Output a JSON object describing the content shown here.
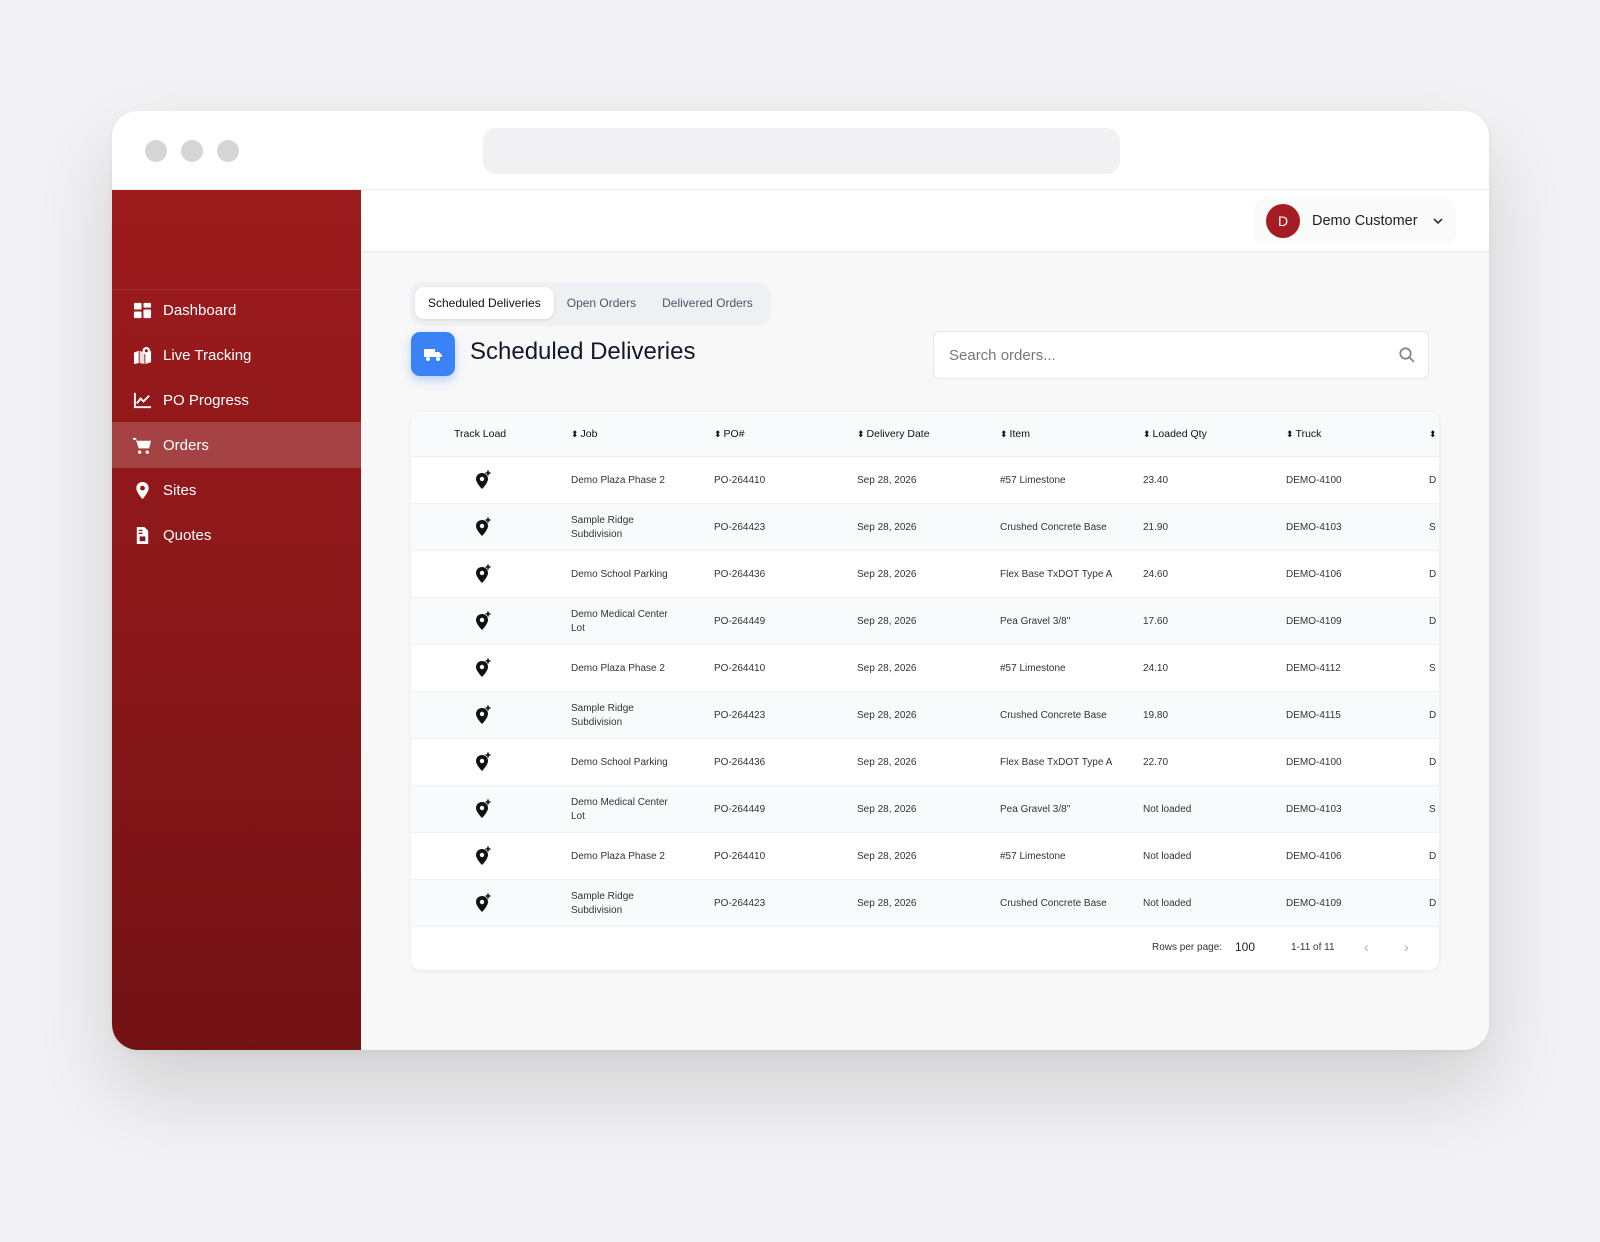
{
  "sidebar": {
    "items": [
      {
        "label": "Dashboard",
        "icon": "dashboard-icon"
      },
      {
        "label": "Live Tracking",
        "icon": "map-pin-icon"
      },
      {
        "label": "PO Progress",
        "icon": "chart-line-icon"
      },
      {
        "label": "Orders",
        "icon": "cart-icon",
        "active": true
      },
      {
        "label": "Sites",
        "icon": "location-pin-icon"
      },
      {
        "label": "Quotes",
        "icon": "file-invoice-icon"
      }
    ]
  },
  "user": {
    "initial": "D",
    "name": "Demo Customer"
  },
  "tabs": [
    "Scheduled Deliveries",
    "Open Orders",
    "Delivered Orders"
  ],
  "page": {
    "title": "Scheduled Deliveries"
  },
  "search": {
    "placeholder": "Search orders..."
  },
  "table": {
    "columns": [
      "Track Load",
      "Job",
      "PO#",
      "Delivery Date",
      "Item",
      "Loaded Qty",
      "Truck"
    ],
    "rows": [
      {
        "job": "Demo Plaza Phase 2",
        "po": "PO-264410",
        "date": "Sep 28, 2026",
        "item": "#57 Limestone",
        "qty": "23.40",
        "truck": "DEMO-4100",
        "next": "D"
      },
      {
        "job": "Sample Ridge Subdivision",
        "po": "PO-264423",
        "date": "Sep 28, 2026",
        "item": "Crushed Concrete Base",
        "qty": "21.90",
        "truck": "DEMO-4103",
        "next": "S"
      },
      {
        "job": "Demo School Parking",
        "po": "PO-264436",
        "date": "Sep 28, 2026",
        "item": "Flex Base TxDOT Type A",
        "qty": "24.60",
        "truck": "DEMO-4106",
        "next": "D"
      },
      {
        "job": "Demo Medical Center Lot",
        "po": "PO-264449",
        "date": "Sep 28, 2026",
        "item": "Pea Gravel 3/8\"",
        "qty": "17.60",
        "truck": "DEMO-4109",
        "next": "D"
      },
      {
        "job": "Demo Plaza Phase 2",
        "po": "PO-264410",
        "date": "Sep 28, 2026",
        "item": "#57 Limestone",
        "qty": "24.10",
        "truck": "DEMO-4112",
        "next": "S"
      },
      {
        "job": "Sample Ridge Subdivision",
        "po": "PO-264423",
        "date": "Sep 28, 2026",
        "item": "Crushed Concrete Base",
        "qty": "19.80",
        "truck": "DEMO-4115",
        "next": "D"
      },
      {
        "job": "Demo School Parking",
        "po": "PO-264436",
        "date": "Sep 28, 2026",
        "item": "Flex Base TxDOT Type A",
        "qty": "22.70",
        "truck": "DEMO-4100",
        "next": "D"
      },
      {
        "job": "Demo Medical Center Lot",
        "po": "PO-264449",
        "date": "Sep 28, 2026",
        "item": "Pea Gravel 3/8\"",
        "qty": "Not loaded",
        "truck": "DEMO-4103",
        "next": "S"
      },
      {
        "job": "Demo Plaza Phase 2",
        "po": "PO-264410",
        "date": "Sep 28, 2026",
        "item": "#57 Limestone",
        "qty": "Not loaded",
        "truck": "DEMO-4106",
        "next": "D"
      },
      {
        "job": "Sample Ridge Subdivision",
        "po": "PO-264423",
        "date": "Sep 28, 2026",
        "item": "Crushed Concrete Base",
        "qty": "Not loaded",
        "truck": "DEMO-4109",
        "next": "D"
      }
    ]
  },
  "pagination": {
    "rows_label": "Rows per page:",
    "rows_value": "100",
    "range": "1-11 of 11"
  },
  "colors": {
    "sidebar": "#9d1b1d",
    "accent_blue": "#3b82f6",
    "fab": "#8e1a2a",
    "avatar": "#a51d22"
  }
}
